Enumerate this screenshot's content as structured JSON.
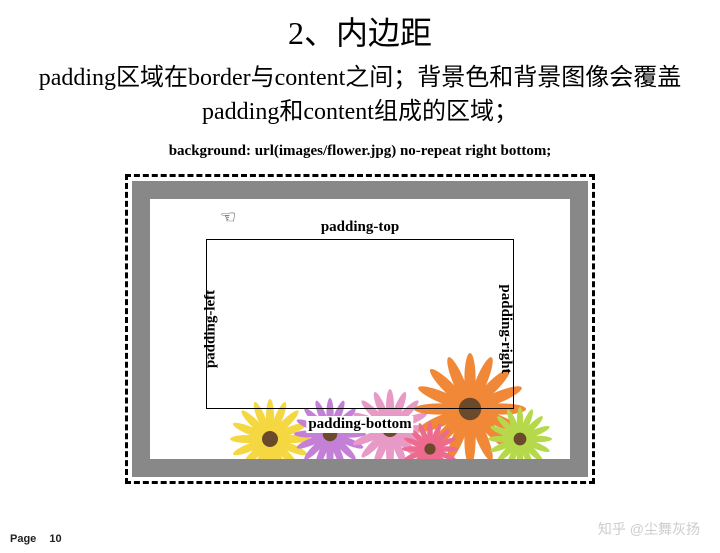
{
  "title": "2、内边距",
  "description": "padding区域在border与content之间；背景色和背景图像会覆盖padding和content组成的区域；",
  "code_line": "background: url(images/flower.jpg) no-repeat right bottom;",
  "labels": {
    "top": "padding-top",
    "bottom": "padding-bottom",
    "left": "padding-left",
    "right": "padding-right"
  },
  "footer": {
    "page_label": "Page",
    "page_number": "10"
  },
  "watermark": "知乎 @尘舞灰扬",
  "cursor_glyph": "☜",
  "flower_colors": {
    "f1": "#f5d742",
    "f2": "#c47fd6",
    "f3": "#e89ac7",
    "f4": "#f08838",
    "f5": "#b6d94c",
    "f6": "#ec6b8f"
  }
}
